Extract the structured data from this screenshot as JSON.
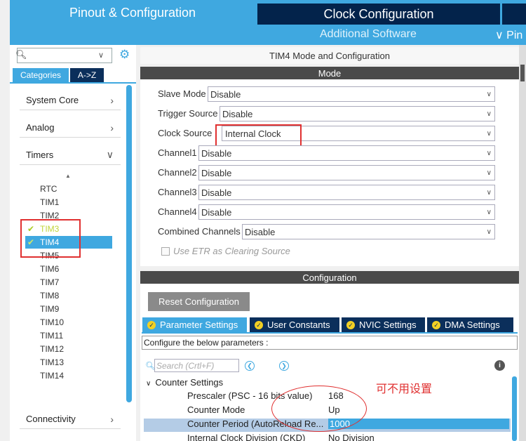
{
  "top_tabs": {
    "pinout": "Pinout & Configuration",
    "clock": "Clock Configuration",
    "additional": "Additional Software",
    "pinout_more": "∨ Pin"
  },
  "left": {
    "search_placeholder": "",
    "tab_categories": "Categories",
    "tab_az": "A->Z",
    "categories": [
      {
        "label": "System Core",
        "chevron": "›"
      },
      {
        "label": "Analog",
        "chevron": "›"
      },
      {
        "label": "Timers",
        "chevron": "∨"
      },
      {
        "label": "Connectivity",
        "chevron": "›"
      }
    ],
    "timers": [
      "RTC",
      "TIM1",
      "TIM2",
      "TIM3",
      "TIM4",
      "TIM5",
      "TIM6",
      "TIM7",
      "TIM8",
      "TIM9",
      "TIM10",
      "TIM11",
      "TIM12",
      "TIM13",
      "TIM14"
    ]
  },
  "mode": {
    "window_title": "TIM4 Mode and Configuration",
    "section": "Mode",
    "rows": [
      {
        "label": "Slave Mode",
        "value": "Disable"
      },
      {
        "label": "Trigger Source",
        "value": "Disable"
      },
      {
        "label": "Clock Source",
        "value": "Internal Clock"
      },
      {
        "label": "Channel1",
        "value": "Disable"
      },
      {
        "label": "Channel2",
        "value": "Disable"
      },
      {
        "label": "Channel3",
        "value": "Disable"
      },
      {
        "label": "Channel4",
        "value": "Disable"
      },
      {
        "label": "Combined Channels",
        "value": "Disable"
      }
    ],
    "etr_label": "Use ETR as Clearing Source"
  },
  "config": {
    "section": "Configuration",
    "reset_button": "Reset Configuration",
    "tabs": [
      "Parameter Settings",
      "User Constants",
      "NVIC Settings",
      "DMA Settings"
    ],
    "configure_text": "Configure the below parameters :",
    "search_placeholder": "Search (Crtl+F)",
    "group": "Counter Settings",
    "params": [
      {
        "key": "Prescaler (PSC - 16 bits value)",
        "value": "168"
      },
      {
        "key": "Counter Mode",
        "value": "Up"
      },
      {
        "key": "Counter Period (AutoReload Re...",
        "value": "1000"
      },
      {
        "key": "Internal Clock Division (CKD)",
        "value": "No Division"
      }
    ]
  },
  "annotation_note": "可不用设置",
  "colors": {
    "accent": "#3fa8e0",
    "dark_tab": "#03234b",
    "highlight_red": "#e03030",
    "check_green": "#aacc22"
  }
}
